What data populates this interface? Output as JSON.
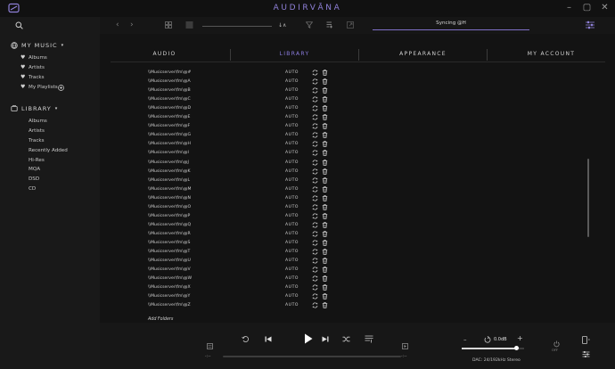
{
  "app": {
    "title": "AUDIRVĀNA"
  },
  "sidebar": {
    "my_music": {
      "header": "MY MUSIC",
      "items": [
        "Albums",
        "Artists",
        "Tracks",
        "My Playlists"
      ]
    },
    "library": {
      "header": "LIBRARY",
      "items": [
        "Albums",
        "Artists",
        "Tracks",
        "Recently Added",
        "Hi-Res",
        "MQA",
        "DSD",
        "CD"
      ]
    }
  },
  "toolbar": {
    "sort_glyph": "↓∧",
    "sync_status": "Syncing @H",
    "sync_progress": 1.0
  },
  "settings": {
    "tabs": [
      "AUDIO",
      "LIBRARY",
      "APPEARANCE",
      "MY ACCOUNT"
    ],
    "active_tab": "LIBRARY",
    "folders": [
      {
        "path": "\\\\Musicserver\\fm\\@#",
        "mode": "AUTO"
      },
      {
        "path": "\\\\Musicserver\\fm\\@A",
        "mode": "AUTO"
      },
      {
        "path": "\\\\Musicserver\\fm\\@B",
        "mode": "AUTO"
      },
      {
        "path": "\\\\Musicserver\\fm\\@C",
        "mode": "AUTO"
      },
      {
        "path": "\\\\Musicserver\\fm\\@D",
        "mode": "AUTO"
      },
      {
        "path": "\\\\Musicserver\\fm\\@E",
        "mode": "AUTO"
      },
      {
        "path": "\\\\Musicserver\\fm\\@F",
        "mode": "AUTO"
      },
      {
        "path": "\\\\Musicserver\\fm\\@G",
        "mode": "AUTO"
      },
      {
        "path": "\\\\Musicserver\\fm\\@H",
        "mode": "AUTO"
      },
      {
        "path": "\\\\Musicserver\\fm\\@I",
        "mode": "AUTO"
      },
      {
        "path": "\\\\Musicserver\\fm\\@J",
        "mode": "AUTO"
      },
      {
        "path": "\\\\Musicserver\\fm\\@K",
        "mode": "AUTO"
      },
      {
        "path": "\\\\Musicserver\\fm\\@L",
        "mode": "AUTO"
      },
      {
        "path": "\\\\Musicserver\\fm\\@M",
        "mode": "AUTO"
      },
      {
        "path": "\\\\Musicserver\\fm\\@N",
        "mode": "AUTO"
      },
      {
        "path": "\\\\Musicserver\\fm\\@O",
        "mode": "AUTO"
      },
      {
        "path": "\\\\Musicserver\\fm\\@P",
        "mode": "AUTO"
      },
      {
        "path": "\\\\Musicserver\\fm\\@Q",
        "mode": "AUTO"
      },
      {
        "path": "\\\\Musicserver\\fm\\@R",
        "mode": "AUTO"
      },
      {
        "path": "\\\\Musicserver\\fm\\@S",
        "mode": "AUTO"
      },
      {
        "path": "\\\\Musicserver\\fm\\@T",
        "mode": "AUTO"
      },
      {
        "path": "\\\\Musicserver\\fm\\@U",
        "mode": "AUTO"
      },
      {
        "path": "\\\\Musicserver\\fm\\@V",
        "mode": "AUTO"
      },
      {
        "path": "\\\\Musicserver\\fm\\@W",
        "mode": "AUTO"
      },
      {
        "path": "\\\\Musicserver\\fm\\@X",
        "mode": "AUTO"
      },
      {
        "path": "\\\\Musicserver\\fm\\@Y",
        "mode": "AUTO"
      },
      {
        "path": "\\\\Musicserver\\fm\\@Z",
        "mode": "AUTO"
      }
    ],
    "add_folders_label": "Add Folders"
  },
  "player": {
    "elapsed": "-:--",
    "remaining": "-:--",
    "volume_label": "0.0dB",
    "volume_level": 0.88,
    "dac_info": "DAC: 24/192kHz Stereo",
    "off_label": "OFF"
  },
  "colors": {
    "accent": "#8c7de0",
    "background": "#141414",
    "sidebar": "#191919"
  },
  "icons": [
    "app-logo-icon",
    "search-icon",
    "back-icon",
    "forward-icon",
    "grid-view-icon",
    "list-view-icon",
    "filter-icon",
    "playlist-add-icon",
    "export-icon",
    "equalizer-settings-icon",
    "heart-icon",
    "plus-icon",
    "globe-icon",
    "library-icon",
    "refresh-icon",
    "trash-icon",
    "repeat-icon",
    "previous-icon",
    "play-icon",
    "next-icon",
    "shuffle-icon",
    "queue-icon",
    "volume-icon",
    "power-icon",
    "device-icon",
    "mixer-icon"
  ]
}
